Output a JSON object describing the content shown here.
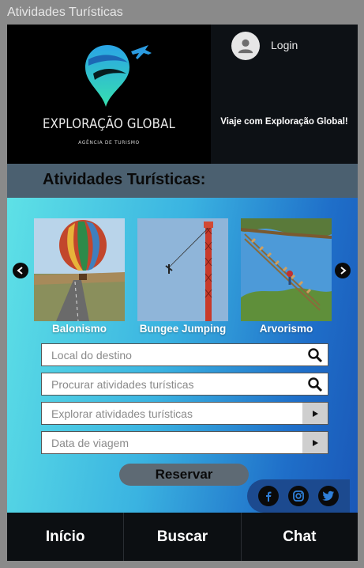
{
  "window": {
    "title": "Atividades Turísticas"
  },
  "header": {
    "brand_name": "EXPLORAÇÃO GLOBAL",
    "brand_subtitle": "AGÊNCIA DE TURISMO",
    "login_label": "Login",
    "tagline": "Viaje com Exploração Global!"
  },
  "section": {
    "title": "Atividades Turísticas:"
  },
  "carousel": {
    "items": [
      {
        "label": "Balonismo"
      },
      {
        "label": "Bungee Jumping"
      },
      {
        "label": "Arvorismo"
      }
    ]
  },
  "form": {
    "destination_placeholder": "Local do destino",
    "search_activities_placeholder": "Procurar atividades turísticas",
    "explore_label": "Explorar atividades turísticas",
    "date_label": "Data de viagem",
    "reserve_label": "Reservar"
  },
  "social": {
    "icons": [
      "facebook-icon",
      "instagram-icon",
      "twitter-icon"
    ]
  },
  "nav": {
    "items": [
      "Início",
      "Buscar",
      "Chat"
    ]
  },
  "colors": {
    "header_bg": "#000000",
    "section_bar": "#4b6070",
    "gradient_start": "#5ee1e6",
    "gradient_end": "#1a58b8",
    "button_bg": "#5e6a74",
    "nav_bg": "#0c0f12"
  }
}
